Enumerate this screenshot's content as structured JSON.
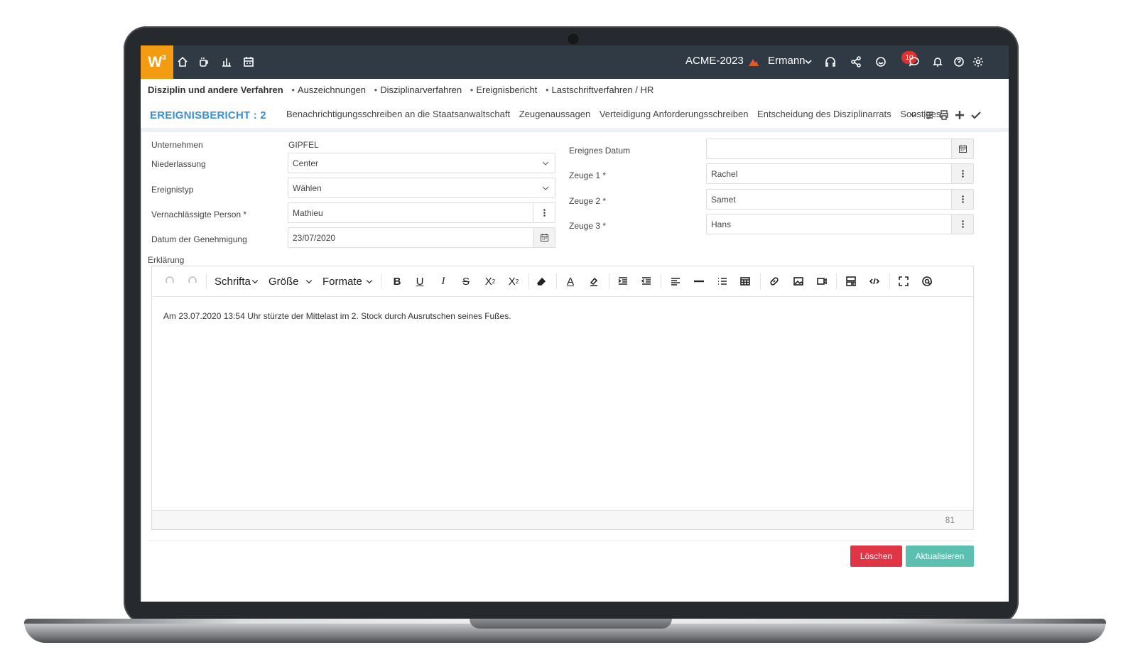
{
  "topbar": {
    "logo": "W",
    "logo_sup": "3",
    "company": "ACME-2023",
    "user": "Ermann",
    "notifications_count": "10",
    "color": "#2f3a44",
    "logo_color": "#f39c12"
  },
  "breadcrumb": {
    "items": [
      "Disziplin und andere Verfahren",
      "Auszeichnungen",
      "Disziplinarverfahren",
      "Ereignisbericht",
      "Lastschriftverfahren / HR"
    ]
  },
  "header": {
    "title": "EREIGNISBERICHT : 2",
    "tabs": [
      "Benachrichtigungsschreiben an die Staatsanwaltschaft",
      "Zeugenaussagen",
      "Verteidigung Anforderungsschreiben",
      "Entscheidung des Disziplinarrats",
      "Sonstiges"
    ]
  },
  "form": {
    "unternehmen_label": "Unternehmen",
    "unternehmen_value": "GIPFEL",
    "niederlassung_label": "Niederlassung",
    "niederlassung_value": "Center",
    "ereignistyp_label": "Ereignistyp",
    "ereignistyp_value": "Wählen",
    "person_label": "Vernachlässigte Person *",
    "person_value": "Mathieu",
    "datum_label": "Datum der Genehmigung",
    "datum_value": "23/07/2020",
    "ereignis_datum_label": "Ereignes Datum",
    "ereignis_datum_value": "",
    "zeuge1_label": "Zeuge 1 *",
    "zeuge1_value": "Rachel",
    "zeuge2_label": "Zeuge 2 *",
    "zeuge2_value": "Samet",
    "zeuge3_label": "Zeuge 3 *",
    "zeuge3_value": "Hans",
    "erklaerung_label": "Erklärung"
  },
  "editor": {
    "font_label": "Schrifta",
    "size_label": "Größe",
    "format_label": "Formate",
    "content": "Am 23.07.2020 13:54 Uhr stürzte der Mittelast im 2. Stock durch Ausrutschen seines Fußes.",
    "char_count": "81"
  },
  "buttons": {
    "delete": "Löschen",
    "update": "Aktualisieren",
    "delete_color": "#e03545",
    "update_color": "#5bc0b0"
  }
}
